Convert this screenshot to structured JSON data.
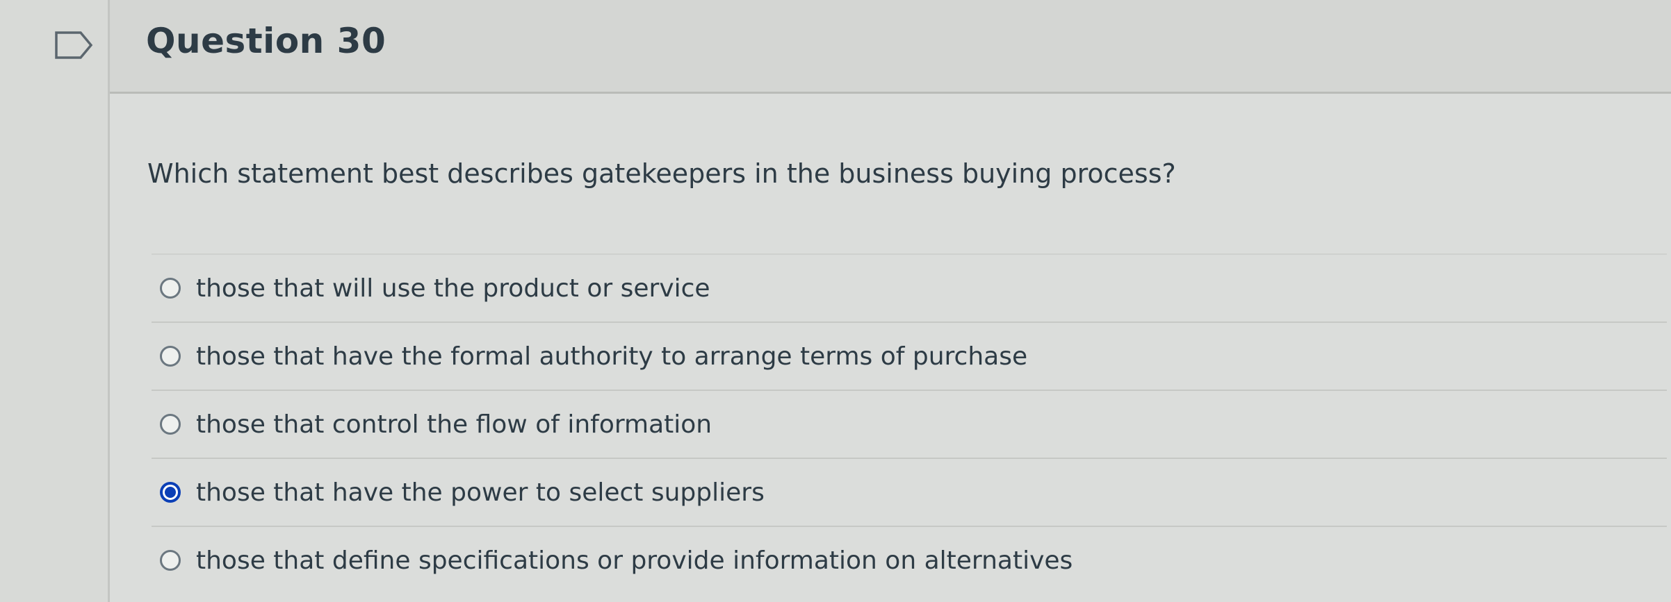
{
  "question": {
    "title": "Question 30",
    "text": "Which statement best describes gatekeepers in the business buying process?",
    "answers": [
      {
        "label": "those that will use the product or service",
        "selected": false
      },
      {
        "label": "those that have the formal authority to arrange terms of purchase",
        "selected": false
      },
      {
        "label": "those that control the flow of information",
        "selected": false
      },
      {
        "label": "those that have the power to select suppliers",
        "selected": true
      },
      {
        "label": "those that define specifications or provide information on alternatives",
        "selected": false
      }
    ]
  },
  "icons": {
    "flag": "flag-question-icon"
  },
  "colors": {
    "selected_radio": "#0b3fb6",
    "text": "#2d3b45",
    "background": "#d9dbd8"
  }
}
